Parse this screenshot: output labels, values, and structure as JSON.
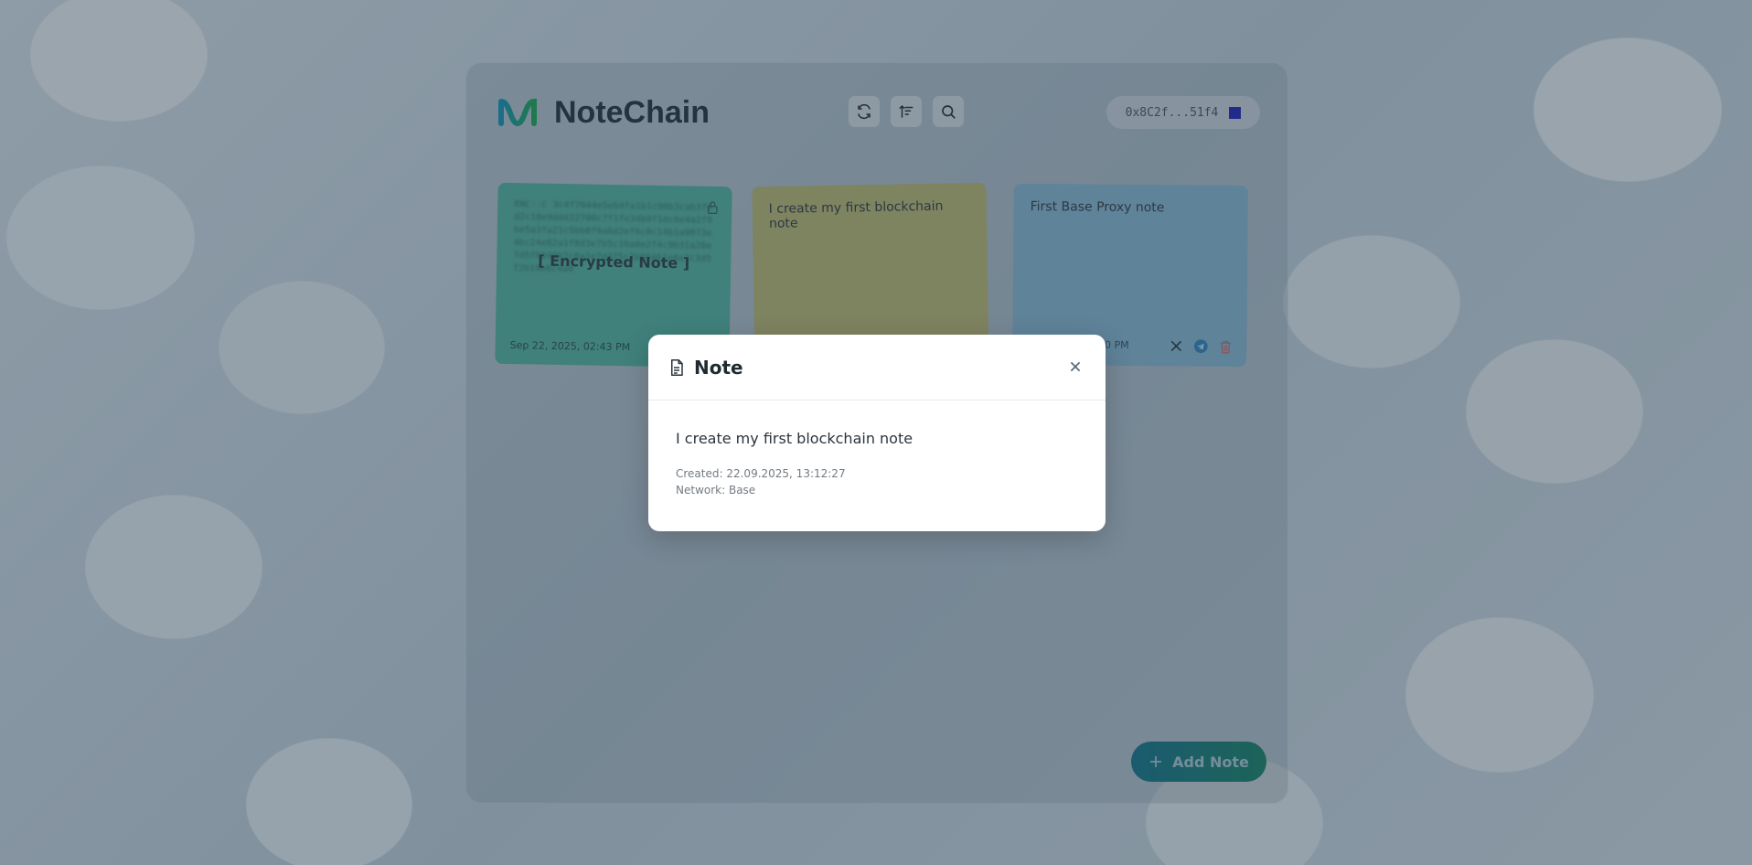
{
  "app": {
    "title": "NoteChain"
  },
  "toolbar": {
    "icons": [
      "refresh-icon",
      "sort-icon",
      "search-icon"
    ]
  },
  "wallet": {
    "address": "0x8C2f...51f4",
    "network_color": "#1a1ab5"
  },
  "notes": [
    {
      "color": "green",
      "encrypted": true,
      "cipher_text": "ENC::C 3c4f7044e5eb4fa1b1c90b3cab3f0d2c18e9dd422700c7f1fe34b9f1dc6e4a2f9be5a3fa21c5bb8f9a6d2ef6c0c14b1a9073e4bc24e82a1f8d3e7b5c16a0e2f4c9b31a28e7d5f6049b2c8a1e7d3f5c2b90461e8a7c3d5f2b19e6c4a0",
      "label": "[ Encrypted Note ]",
      "date": "Sep 22, 2025, 02:43 PM"
    },
    {
      "color": "yellow",
      "text": "I create my first blockchain note"
    },
    {
      "color": "blue",
      "text": "First Base Proxy note",
      "date": ":20 PM"
    }
  ],
  "add_button": {
    "label": "Add Note"
  },
  "modal": {
    "title": "Note",
    "content": "I create my first blockchain note",
    "created": "Created: 22.09.2025, 13:12:27",
    "network": "Network: Base"
  }
}
